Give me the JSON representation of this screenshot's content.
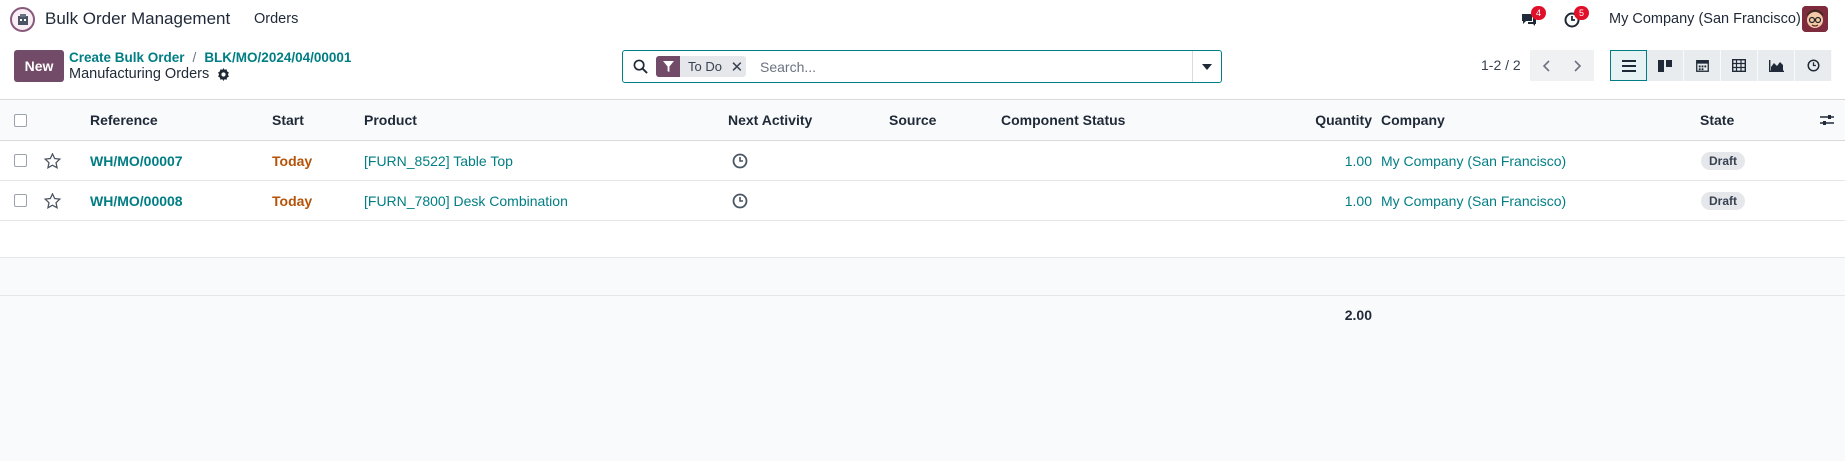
{
  "topbar": {
    "app_title": "Bulk Order Management",
    "menu_orders": "Orders",
    "messages_badge": "4",
    "activities_badge": "5",
    "company": "My Company (San Francisco)"
  },
  "control_panel": {
    "new_label": "New",
    "breadcrumb": [
      "Create Bulk Order",
      "BLK/MO/2024/04/00001"
    ],
    "title": "Manufacturing Orders",
    "facet_label": "To Do",
    "search_placeholder": "Search...",
    "pager": "1-2 / 2",
    "views": [
      "list-view-icon",
      "kanban-view-icon",
      "calendar-view-icon",
      "pivot-view-icon",
      "graph-view-icon",
      "activity-view-icon"
    ],
    "active_view": "list-view-icon"
  },
  "table": {
    "columns": {
      "reference": "Reference",
      "start": "Start",
      "product": "Product",
      "next_activity": "Next Activity",
      "source": "Source",
      "component_status": "Component Status",
      "quantity": "Quantity",
      "company": "Company",
      "state": "State"
    },
    "rows": [
      {
        "reference": "WH/MO/00007",
        "start": "Today",
        "product": "[FURN_8522] Table Top",
        "source": "",
        "component_status": "",
        "quantity": "1.00",
        "company": "My Company (San Francisco)",
        "state": "Draft"
      },
      {
        "reference": "WH/MO/00008",
        "start": "Today",
        "product": "[FURN_7800] Desk Combination",
        "source": "",
        "component_status": "",
        "quantity": "1.00",
        "company": "My Company (San Francisco)",
        "state": "Draft"
      }
    ],
    "total_quantity": "2.00"
  },
  "colors": {
    "brand": "#714b67",
    "link": "#017e84",
    "today": "#b45309",
    "badge": "#e0102a"
  }
}
